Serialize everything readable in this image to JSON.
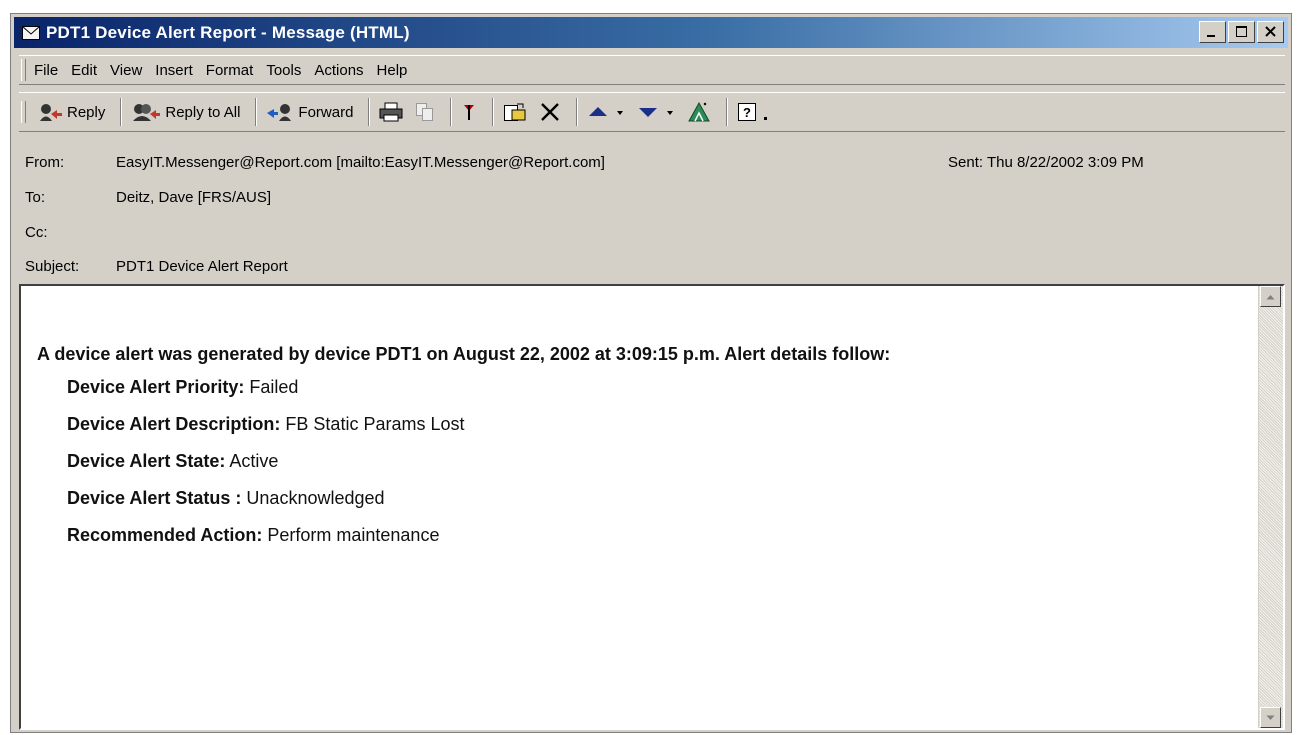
{
  "window": {
    "title": "PDT1 Device Alert Report  - Message (HTML)",
    "controls": [
      "minimize",
      "maximize",
      "close"
    ]
  },
  "menu": {
    "items": [
      "File",
      "Edit",
      "View",
      "Insert",
      "Format",
      "Tools",
      "Actions",
      "Help"
    ]
  },
  "toolbar": {
    "reply_label": "Reply",
    "reply_all_label": "Reply to All",
    "forward_label": "Forward",
    "icons": [
      "reply-icon",
      "reply-all-icon",
      "forward-icon",
      "print-icon",
      "copy-icon",
      "flag-icon",
      "move-to-folder-icon",
      "delete-icon",
      "previous-item-icon",
      "next-item-icon",
      "address-book-icon",
      "help-icon"
    ]
  },
  "headers": {
    "from_label": "From:",
    "from_value": "EasyIT.Messenger@Report.com [mailto:EasyIT.Messenger@Report.com]",
    "sent_label": "Sent:",
    "sent_value": "Thu 8/22/2002 3:09 PM",
    "to_label": "To:",
    "to_value": "Deitz, Dave [FRS/AUS]",
    "cc_label": "Cc:",
    "cc_value": "",
    "subject_label": "Subject:",
    "subject_value": "PDT1 Device Alert Report"
  },
  "message": {
    "intro": "A device alert was generated by device PDT1 on August 22, 2002 at  3:09:15  p.m.  Alert details follow:",
    "details": [
      {
        "label": "Device Alert Priority:",
        "value": "Failed"
      },
      {
        "label": "Device Alert Description:",
        "value": "FB Static Params Lost"
      },
      {
        "label": "Device Alert State:",
        "value": " Active"
      },
      {
        "label": "Device Alert Status :",
        "value": " Unacknowledged"
      },
      {
        "label": "Recommended Action:",
        "value": "Perform maintenance"
      }
    ]
  },
  "colors": {
    "titlebar_start": "#0a246a",
    "titlebar_end": "#a6caf0",
    "chrome": "#d4d0c8"
  }
}
